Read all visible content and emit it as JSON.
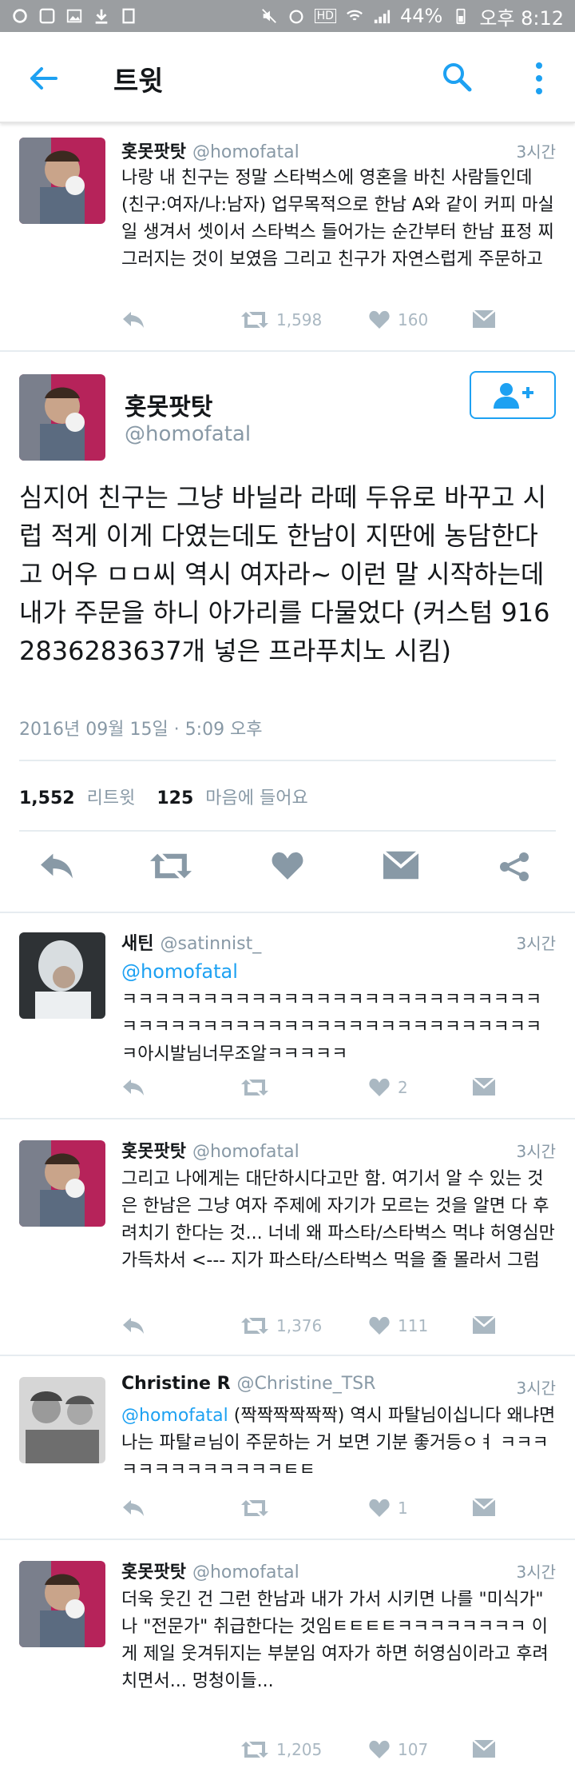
{
  "status_bar": {
    "battery": "44%",
    "time": "오후 8:12",
    "hd": "HD"
  },
  "appbar": {
    "title": "트윗",
    "back_icon": "arrow-left-icon",
    "search_icon": "search-icon",
    "more_icon": "more-vertical-icon"
  },
  "colors": {
    "accent": "#1da1f2",
    "muted": "#8899a6",
    "icon_gray": "#aab8c2",
    "statusbar": "#9b9ea1"
  },
  "tweets_above": [
    {
      "name": "홋못팟탓",
      "handle": "@homofatal",
      "time": "3시간",
      "text": "나랑 내 친구는 정말 스타벅스에 영혼을 바친 사람들인데 (친구:여자/나:남자) 업무목적으로 한남 A와 같이 커피 마실 일 생겨서 셋이서 스타벅스 들어가는 순간부터 한남 표정 찌그러지는 것이 보였음 그리고 친구가 자연스럽게 주문하고",
      "retweets": "1,598",
      "likes": "160"
    }
  ],
  "main_tweet": {
    "name": "홋못팟탓",
    "handle": "@homofatal",
    "text": "심지어 친구는 그냥 바닐라 라떼 두유로 바꾸고 시럽 적게 이게 다였는데도 한남이 지딴에 농담한다고 어우 ㅁㅁ씨 역시 여자라~ 이런 말 시작하는데 내가 주문을 하니 아가리를 다물었다 (커스텀 9162836283637개 넣은 프라푸치노 시킴)",
    "date": "2016년 09월 15일 · 5:09 오후",
    "retweet_count": "1,552",
    "retweet_label": "리트윗",
    "like_count": "125",
    "like_label": "마음에 들어요"
  },
  "replies": [
    {
      "name": "새틴",
      "handle": "@satinnist_",
      "time": "3시간",
      "mention": "@homofatal",
      "text": "ㅋㅋㅋㅋㅋㅋㅋㅋㅋㅋㅋㅋㅋㅋㅋㅋㅋㅋㅋㅋㅋㅋㅋㅋㅋㅋㅋㅋㅋㅋㅋㅋㅋㅋㅋㅋㅋㅋㅋㅋㅋㅋㅋㅋㅋㅋㅋㅋㅋㅋㅋㅋㅋ아시발님너무조알ㅋㅋㅋㅋㅋ",
      "retweets": "",
      "likes": "2"
    },
    {
      "name": "홋못팟탓",
      "handle": "@homofatal",
      "time": "3시간",
      "mention": "",
      "text": "그리고 나에게는 대단하시다고만 함. 여기서 알 수 있는 것은 한남은 그냥 여자 주제에 자기가 모르는 것을 알면 다 후려치기 한다는 것... 너네 왜 파스타/스타벅스 먹냐 허영심만 가득차서 <--- 지가 파스타/스타벅스 먹을 줄 몰라서 그럼",
      "retweets": "1,376",
      "likes": "111"
    },
    {
      "name": "Christine R",
      "handle": "@Christine_TSR",
      "time": "3시간",
      "mention": "@homofatal",
      "text": " (짝짝짝짝짝짝) 역시 파탈님이십니다 왜냐면 나는 파탈ㄹ님이 주문하는 거 보면 기분 좋거등ㅇㅕ ㅋㅋㅋㅋㅋㅋㅋㅋㅋㅋㅋㅋㅋㅌㅌ",
      "retweets": "",
      "likes": "1"
    },
    {
      "name": "홋못팟탓",
      "handle": "@homofatal",
      "time": "3시간",
      "mention": "",
      "text": "더욱 웃긴 건 그런 한남과 내가 가서 시키면 나를 \"미식가\" 나 \"전문가\" 취급한다는 것임ㅌㅌㅌㅌㅋㅋㅋㅋㅋㅋㅋㅋ 이게 제일 웃겨뒤지는 부분임 여자가 하면 허영심이라고 후려치면서... 멍청이들...",
      "retweets": "1,205",
      "likes": "107"
    }
  ]
}
